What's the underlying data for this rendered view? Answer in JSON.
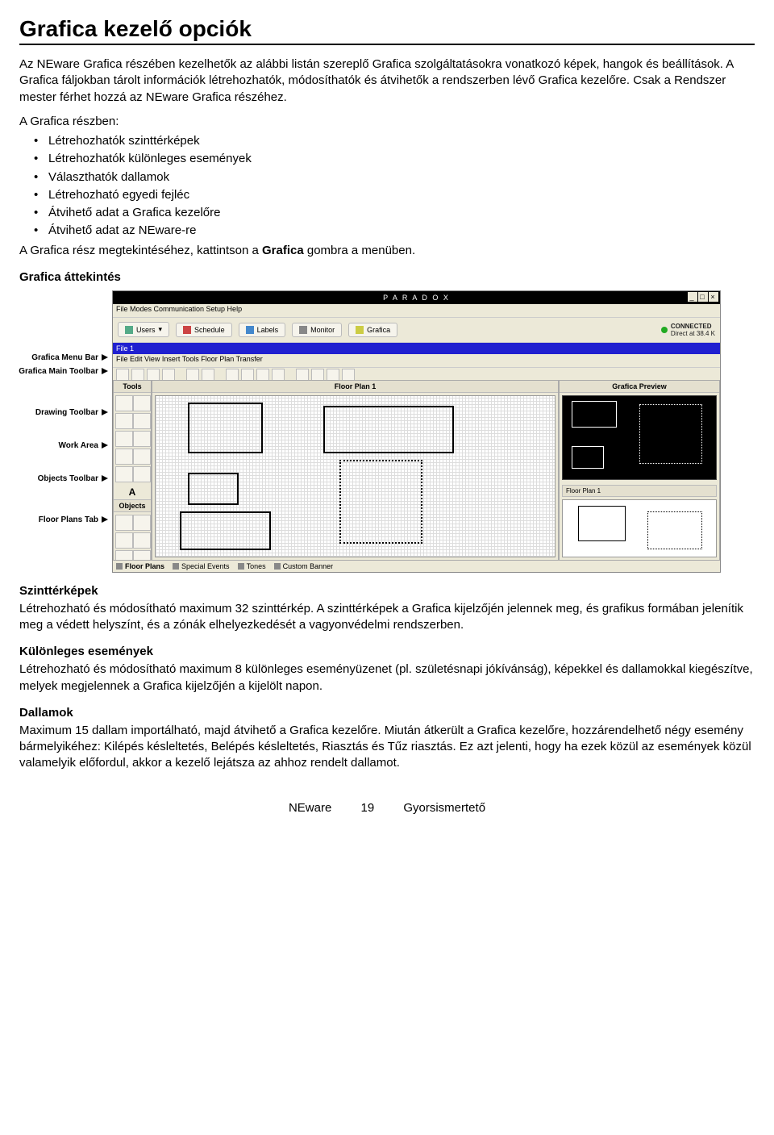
{
  "title": "Grafica kezelő opciók",
  "intro": "Az NEware Grafica részében kezelhetők az alábbi listán szereplő Grafica szolgáltatásokra vonatkozó képek, hangok és beállítások. A Grafica fáljokban tárolt információk létrehozhatók, módosíthatók és átvihetők a rendszerben lévő Grafica kezelőre. Csak a Rendszer mester férhet hozzá az NEware Grafica részéhez.",
  "list_intro": "A Grafica részben:",
  "bullets": [
    "Létrehozhatók szinttérképek",
    "Létrehozhatók különleges események",
    "Választhatók dallamok",
    "Létrehozható egyedi fejléc",
    "Átvihető adat a Grafica kezelőre",
    "Átvihető adat az NEware-re"
  ],
  "after_list_pre": "A Grafica rész megtekintéséhez, kattintson a ",
  "after_list_bold": "Grafica",
  "after_list_post": " gombra a menüben.",
  "overview_heading": "Grafica áttekintés",
  "labels": {
    "menu_bar": "Grafica Menu Bar",
    "main_toolbar": "Grafica Main Toolbar",
    "drawing_toolbar": "Drawing Toolbar",
    "work_area": "Work Area",
    "objects_toolbar": "Objects Toolbar",
    "floor_plans_tab": "Floor Plans Tab"
  },
  "app": {
    "brand": "P  A  R  A  D  O  X",
    "menu": "File   Modes   Communication   Setup   Help",
    "tb1": {
      "users": "Users",
      "schedule": "Schedule",
      "labels": "Labels",
      "monitor": "Monitor",
      "grafica": "Grafica"
    },
    "status": {
      "connected": "CONNECTED",
      "rate": "Direct at 38.4 K"
    },
    "file_tab": "File 1",
    "gmenu": "File   Edit   View   Insert   Tools   Floor Plan   Transfer",
    "panels": {
      "tools": "Tools",
      "floor": "Floor Plan 1",
      "preview": "Grafica Preview",
      "objects": "Objects",
      "preview_item": "Floor Plan 1"
    },
    "tabs": {
      "floor_plans": "Floor Plans",
      "special_events": "Special Events",
      "tones": "Tones",
      "custom_banner": "Custom Banner"
    },
    "letter_a": "A"
  },
  "sections": {
    "s1_title": "Szinttérképek",
    "s1_body": "Létrehozható és módosítható maximum 32 szinttérkép. A szinttérképek a Grafica kijelzőjén jelennek meg, és grafikus formában jelenítik meg a védett helyszínt, és a zónák elhelyezkedését a vagyonvédelmi rendszerben.",
    "s2_title": "Különleges események",
    "s2_body": "Létrehozható és módosítható maximum 8 különleges eseményüzenet (pl. születésnapi jókívánság), képekkel és dallamokkal kiegészítve, melyek megjelennek a Grafica kijelzőjén a kijelölt napon.",
    "s3_title": "Dallamok",
    "s3_body": "Maximum 15 dallam importálható, majd átvihető a Grafica kezelőre. Miután átkerült a Grafica kezelőre, hozzárendelhető négy esemény bármelyikéhez: Kilépés késleltetés, Belépés késleltetés, Riasztás és Tűz riasztás. Ez azt jelenti, hogy ha ezek közül az események közül valamelyik előfordul, akkor a kezelő lejátsza az ahhoz rendelt dallamot."
  },
  "footer": {
    "product": "NEware",
    "page": "19",
    "doc": "Gyorsismertető"
  }
}
